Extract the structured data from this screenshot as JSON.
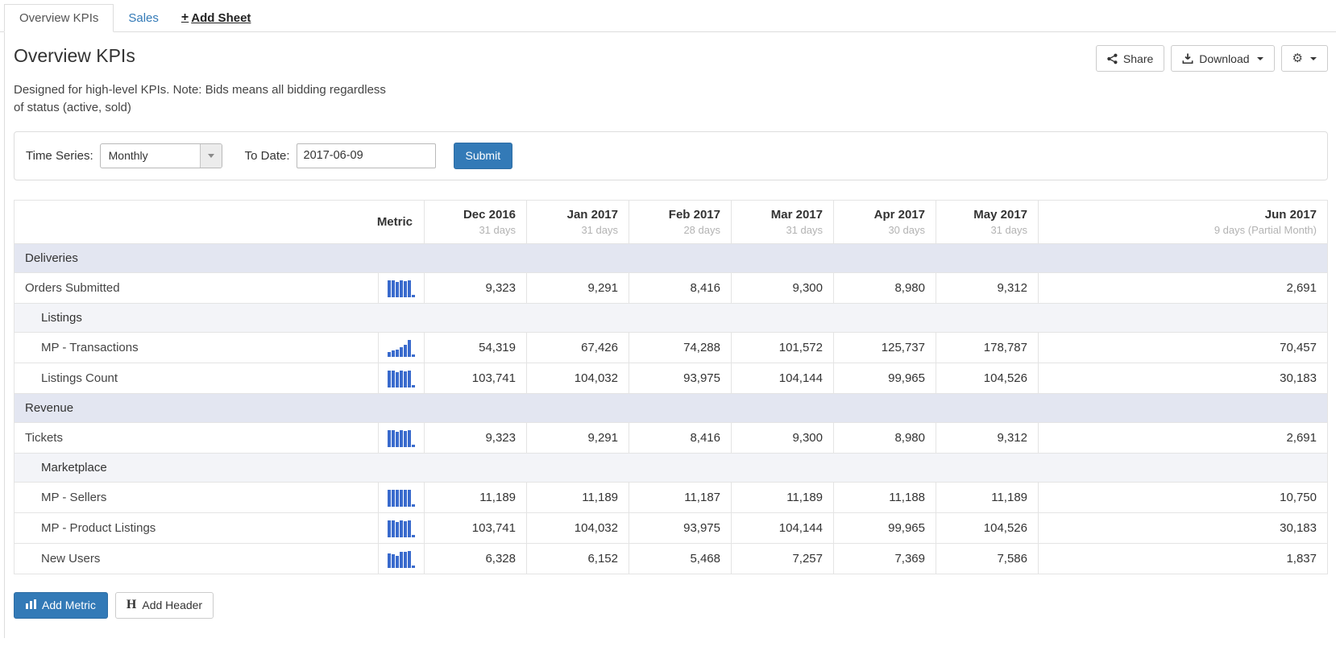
{
  "tabs": [
    {
      "label": "Overview KPIs",
      "active": true
    },
    {
      "label": "Sales",
      "active": false
    },
    {
      "label": "Add Sheet",
      "active": false
    }
  ],
  "header": {
    "title": "Overview KPIs",
    "description": "Designed for high-level KPIs. Note: Bids means all bidding regardless of status (active, sold)",
    "share_label": "Share",
    "download_label": "Download"
  },
  "filters": {
    "time_series_label": "Time Series:",
    "time_series_value": "Monthly",
    "to_date_label": "To Date:",
    "to_date_value": "2017-06-09",
    "submit_label": "Submit"
  },
  "table": {
    "metric_header": "Metric",
    "columns": [
      {
        "month": "Dec 2016",
        "days": "31 days"
      },
      {
        "month": "Jan 2017",
        "days": "31 days"
      },
      {
        "month": "Feb 2017",
        "days": "28 days"
      },
      {
        "month": "Mar 2017",
        "days": "31 days"
      },
      {
        "month": "Apr 2017",
        "days": "30 days"
      },
      {
        "month": "May 2017",
        "days": "31 days"
      },
      {
        "month": "Jun 2017",
        "days": "9 days (Partial Month)"
      }
    ],
    "rows": [
      {
        "type": "section",
        "label": "Deliveries"
      },
      {
        "type": "metric",
        "label": "Orders Submitted",
        "indent": false,
        "values": [
          "9,323",
          "9,291",
          "8,416",
          "9,300",
          "8,980",
          "9,312",
          "2,691"
        ]
      },
      {
        "type": "subsection",
        "label": "Listings"
      },
      {
        "type": "metric",
        "label": "MP - Transactions",
        "indent": true,
        "values": [
          "54,319",
          "67,426",
          "74,288",
          "101,572",
          "125,737",
          "178,787",
          "70,457"
        ]
      },
      {
        "type": "metric",
        "label": "Listings Count",
        "indent": true,
        "values": [
          "103,741",
          "104,032",
          "93,975",
          "104,144",
          "99,965",
          "104,526",
          "30,183"
        ]
      },
      {
        "type": "section",
        "label": "Revenue"
      },
      {
        "type": "metric",
        "label": "Tickets",
        "indent": false,
        "values": [
          "9,323",
          "9,291",
          "8,416",
          "9,300",
          "8,980",
          "9,312",
          "2,691"
        ]
      },
      {
        "type": "subsection",
        "label": "Marketplace"
      },
      {
        "type": "metric",
        "label": "MP - Sellers",
        "indent": true,
        "values": [
          "11,189",
          "11,189",
          "11,187",
          "11,189",
          "11,188",
          "11,189",
          "10,750"
        ]
      },
      {
        "type": "metric",
        "label": "MP - Product Listings",
        "indent": true,
        "values": [
          "103,741",
          "104,032",
          "93,975",
          "104,144",
          "99,965",
          "104,526",
          "30,183"
        ]
      },
      {
        "type": "metric",
        "label": "New Users",
        "indent": true,
        "values": [
          "6,328",
          "6,152",
          "5,468",
          "7,257",
          "7,369",
          "7,586",
          "1,837"
        ]
      }
    ]
  },
  "footer": {
    "add_metric_label": "Add Metric",
    "add_header_label": "Add Header"
  },
  "colors": {
    "accent_blue": "#337ab7",
    "sparkline_blue": "#3a6bcd",
    "section_bg": "#e3e6f1",
    "subsection_bg": "#f3f4f8"
  }
}
